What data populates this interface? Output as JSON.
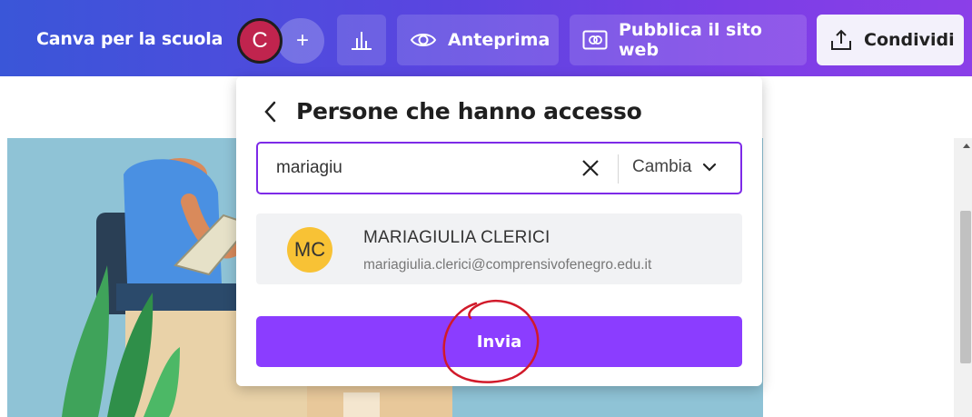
{
  "topbar": {
    "brand": "Canva per la scuola",
    "user_initial": "C",
    "add_symbol": "+",
    "preview_label": "Anteprima",
    "publish_label": "Pubblica il sito web",
    "share_label": "Condividi",
    "icons": [
      "plus-icon",
      "insights-icon",
      "eye-icon",
      "publish-icon",
      "share-upload-icon"
    ]
  },
  "panel": {
    "title": "Persone che hanno accesso",
    "search": {
      "value": "mariagiu"
    },
    "role_select": {
      "selected": "Cambia"
    },
    "result": {
      "initials": "MC",
      "name": "MARIAGIULIA CLERICI",
      "email": "mariagiulia.clerici@comprensivofenegro.edu.it",
      "avatar_color": "#f8c235"
    },
    "send_label": "Invia"
  },
  "colors": {
    "accent": "#8b3dff",
    "topbar_start": "#3a56d8",
    "topbar_end": "#8b3fe8",
    "user_avatar": "#c0244e",
    "annotation": "#d11a2a"
  }
}
